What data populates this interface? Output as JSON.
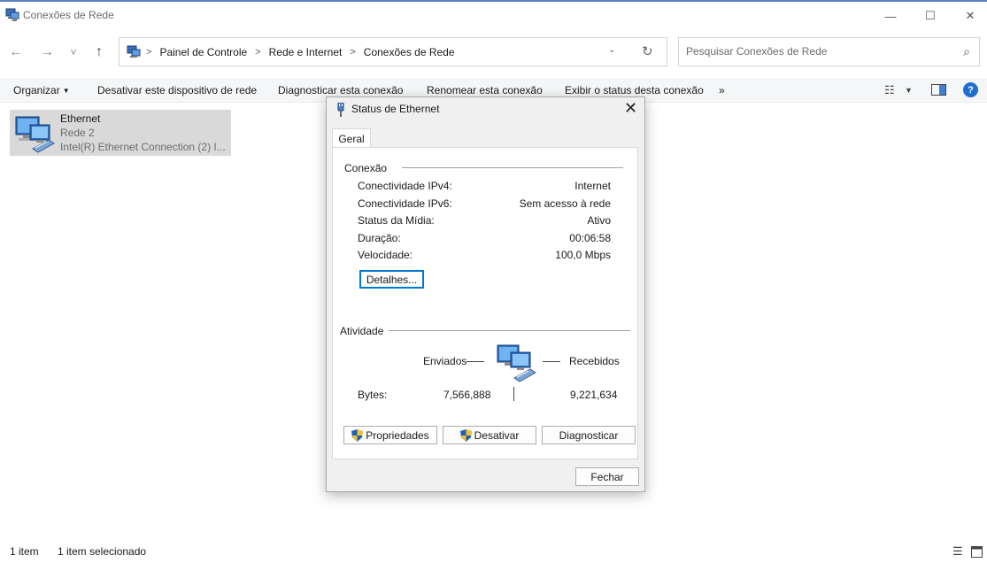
{
  "window": {
    "title": "Conexões de Rede",
    "controls": {
      "minimize": "—",
      "maximize": "☐",
      "close": "✕"
    }
  },
  "nav": {
    "back": "←",
    "forward": "→",
    "recent": "˅",
    "up": "↑",
    "breadcrumbs": [
      "Painel de Controle",
      "Rede e Internet",
      "Conexões de Rede"
    ],
    "separator": ">",
    "dropdown": "⌄",
    "refresh": "↻"
  },
  "search": {
    "placeholder": "Pesquisar Conexões de Rede",
    "icon": "⌕"
  },
  "commands": {
    "organize": "Organizar",
    "disable": "Desativar este dispositivo de rede",
    "diagnose": "Diagnosticar esta conexão",
    "rename": "Renomear esta conexão",
    "view_status": "Exibir o status desta conexão",
    "more": "»"
  },
  "item": {
    "name": "Ethernet",
    "network": "Rede 2",
    "adapter": "Intel(R) Ethernet Connection (2) I..."
  },
  "statusbar": {
    "count": "1 item",
    "selected": "1 item selecionado"
  },
  "dialog": {
    "title": "Status de Ethernet",
    "close": "✕",
    "tab": "Geral",
    "connection": {
      "heading": "Conexão",
      "rows": [
        {
          "label": "Conectividade IPv4:",
          "value": "Internet"
        },
        {
          "label": "Conectividade IPv6:",
          "value": "Sem acesso à rede"
        },
        {
          "label": "Status da Mídia:",
          "value": "Ativo"
        },
        {
          "label": "Duração:",
          "value": "00:06:58"
        },
        {
          "label": "Velocidade:",
          "value": "100,0 Mbps"
        }
      ],
      "details_button": "Detalhes..."
    },
    "activity": {
      "heading": "Atividade",
      "sent_label": "Enviados",
      "received_label": "Recebidos",
      "bytes_label": "Bytes:",
      "bytes_sent": "7,566,888",
      "bytes_received": "9,221,634"
    },
    "buttons": {
      "properties": "Propriedades",
      "disable": "Desativar",
      "diagnose": "Diagnosticar",
      "close": "Fechar"
    }
  },
  "colors": {
    "accent": "#0078d7",
    "selection": "#d9d9d9",
    "help": "#1f6fd1"
  }
}
